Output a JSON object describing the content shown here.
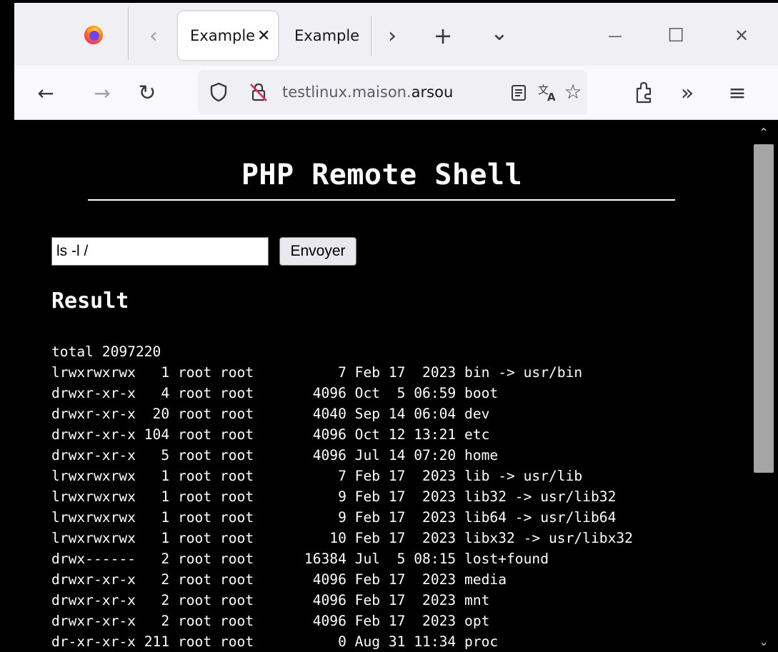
{
  "browser": {
    "tabs": [
      {
        "title": "Example",
        "active": true,
        "close_label": "✕"
      },
      {
        "title": "Example",
        "active": false
      }
    ],
    "icons": {
      "firefox": "firefox-logo-icon",
      "tab_scroll_left": "‹",
      "tab_scroll_right": "›",
      "new_tab": "+",
      "list_all_tabs": "⌄",
      "minimize": "—",
      "maximize": "☐",
      "close": "✕",
      "back": "←",
      "forward": "→",
      "reload": "↻",
      "tracking_protection": "shield-icon",
      "insecure": "lock-strike-icon",
      "reader": "reader-view-icon",
      "translate": "translate-icon",
      "bookmark": "☆",
      "extensions": "extensions-icon",
      "overflow": "»",
      "menu": "≡"
    },
    "url": {
      "host_prefix": "testlinux.maison.",
      "host_domain": "arsou"
    }
  },
  "page": {
    "title": "PHP Remote Shell",
    "command_value": "ls -l /",
    "submit_label": "Envoyer",
    "result_heading": "Result",
    "result_lines": [
      "total 2097220",
      "lrwxrwxrwx   1 root root          7 Feb 17  2023 bin -> usr/bin",
      "drwxr-xr-x   4 root root       4096 Oct  5 06:59 boot",
      "drwxr-xr-x  20 root root       4040 Sep 14 06:04 dev",
      "drwxr-xr-x 104 root root       4096 Oct 12 13:21 etc",
      "drwxr-xr-x   5 root root       4096 Jul 14 07:20 home",
      "lrwxrwxrwx   1 root root          7 Feb 17  2023 lib -> usr/lib",
      "lrwxrwxrwx   1 root root          9 Feb 17  2023 lib32 -> usr/lib32",
      "lrwxrwxrwx   1 root root          9 Feb 17  2023 lib64 -> usr/lib64",
      "lrwxrwxrwx   1 root root         10 Feb 17  2023 libx32 -> usr/libx32",
      "drwx------   2 root root      16384 Jul  5 08:15 lost+found",
      "drwxr-xr-x   2 root root       4096 Feb 17  2023 media",
      "drwxr-xr-x   2 root root       4096 Feb 17  2023 mnt",
      "drwxr-xr-x   2 root root       4096 Feb 17  2023 opt",
      "dr-xr-xr-x 211 root root          0 Aug 31 11:34 proc"
    ]
  },
  "scrollbar": {
    "up_arrow": "⌃",
    "down_arrow": "⌄",
    "position_fraction": 0.0
  },
  "colors": {
    "page_background": "#000000",
    "page_text": "#ffffff",
    "chrome_background": "#f0f0f4",
    "toolbar_background": "#f9f9fb",
    "url_bar_background": "#f0f0f4"
  }
}
